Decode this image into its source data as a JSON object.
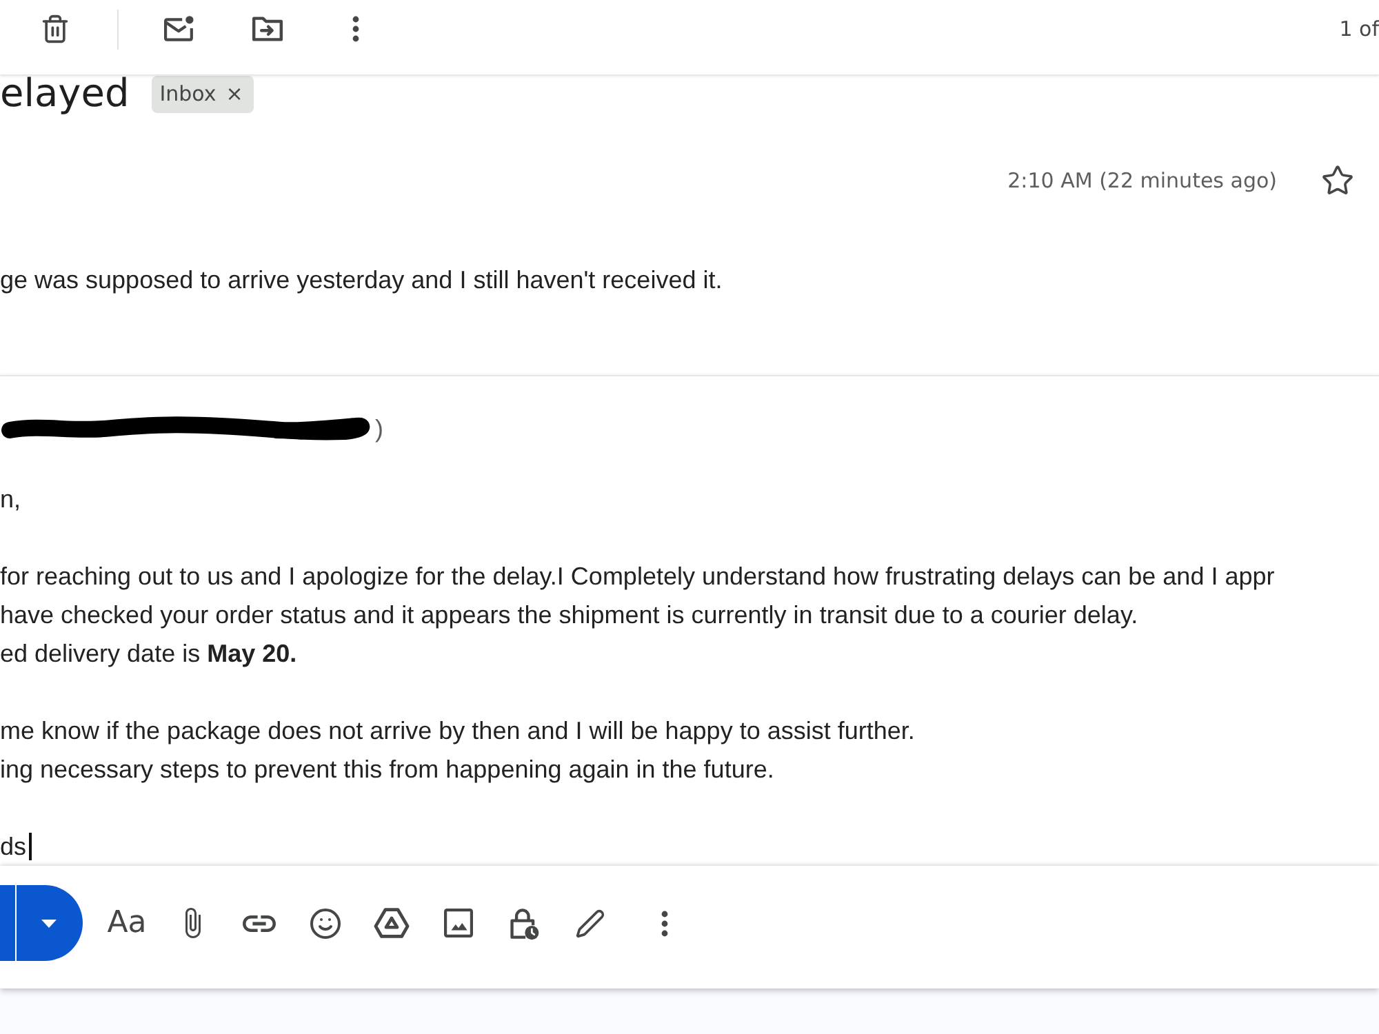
{
  "toolbar": {
    "pagination": "1 of"
  },
  "message": {
    "subject": "elayed",
    "labels": [
      {
        "name": "Inbox",
        "remove_symbol": "×"
      }
    ],
    "time": "2:10 AM (22 minutes ago)",
    "starred": false,
    "body": "ge was supposed to arrive yesterday and I still haven't received it."
  },
  "reply": {
    "recipients_tail": ")",
    "paragraphs": [
      {
        "lines": [
          "n,"
        ],
        "cursor": false
      },
      {
        "lines": [
          "for reaching out to us and I apologize for the delay.I Completely understand how frustrating delays can be and I appr",
          "have checked your order status and it appears the shipment is currently in transit due to a courier delay.",
          "ed delivery date is **May 20.**"
        ],
        "cursor": false
      },
      {
        "lines": [
          "me know if the package does not arrive by then and I will be happy to assist further.",
          "ing necessary steps to prevent this from happening again in the future."
        ],
        "cursor": false
      },
      {
        "lines": [
          "ds"
        ],
        "cursor": true
      }
    ]
  },
  "compose_toolbar": {
    "format_label": "Aa"
  }
}
